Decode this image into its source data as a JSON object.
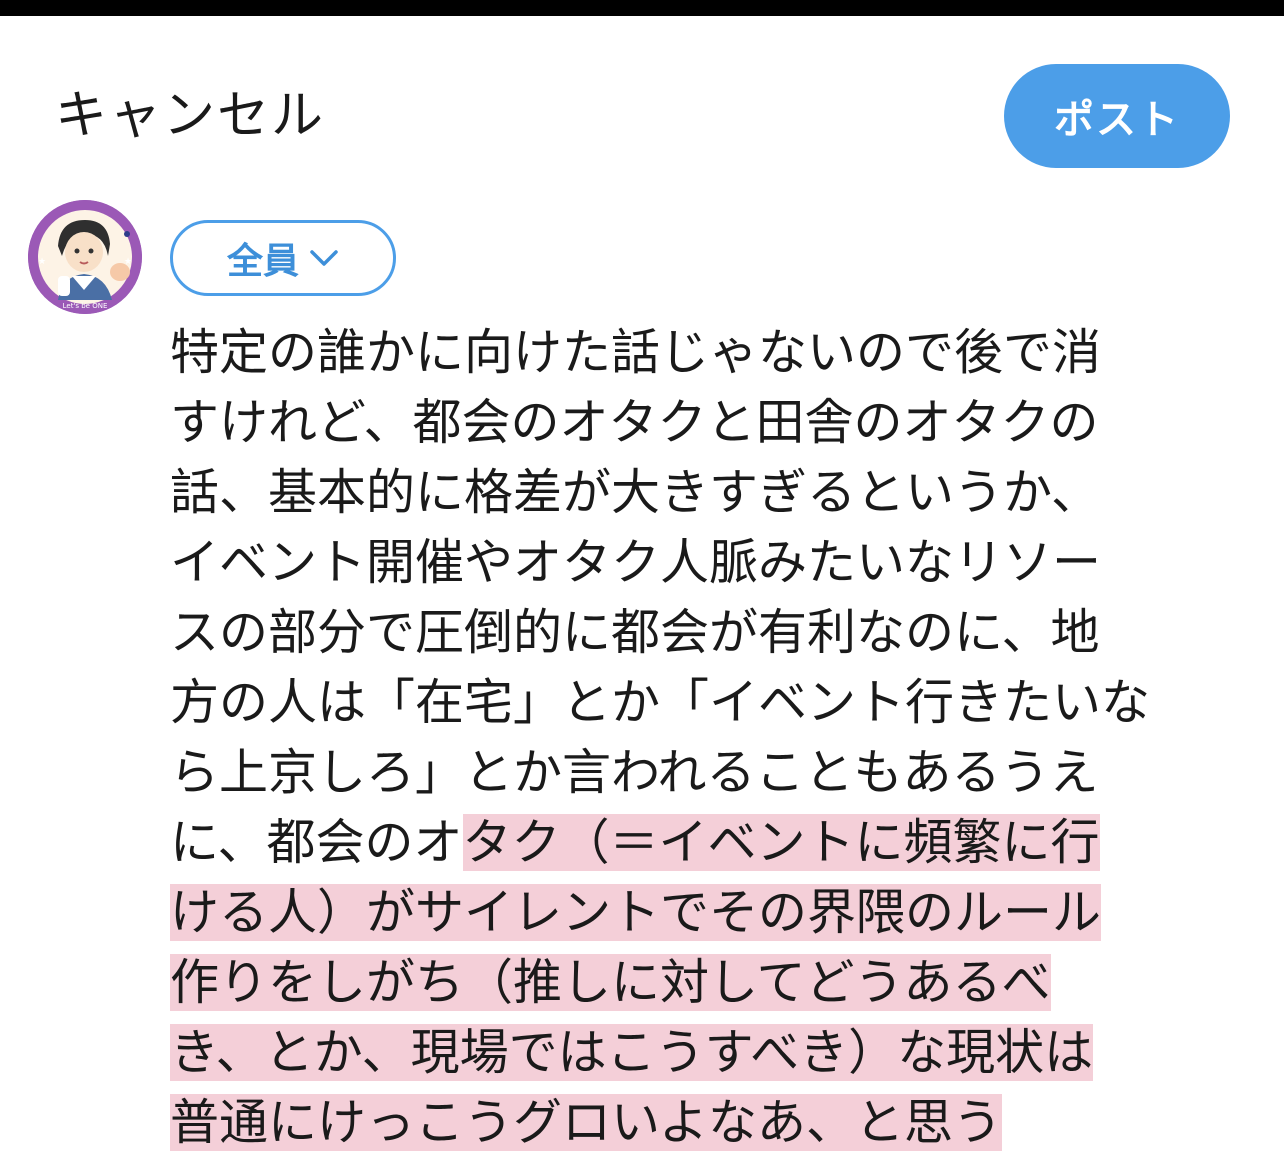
{
  "header": {
    "cancel_label": "キャンセル",
    "post_label": "ポスト"
  },
  "composer": {
    "audience_label": "全員",
    "avatar_caption": "Let's be ONE",
    "lines": [
      {
        "plain": "特定の誰かに向けた話じゃないので後で消",
        "highlight": ""
      },
      {
        "plain": "すけれど、都会のオタクと田舎のオタクの",
        "highlight": ""
      },
      {
        "plain": "話、基本的に格差が大きすぎるというか、",
        "highlight": ""
      },
      {
        "plain": "イベント開催やオタク人脈みたいなリソー",
        "highlight": ""
      },
      {
        "plain": "スの部分で圧倒的に都会が有利なのに、地",
        "highlight": ""
      },
      {
        "plain": "方の人は「在宅」とか「イベント行きたいな",
        "highlight": ""
      },
      {
        "plain": "ら上京しろ」とか言われることもあるうえ",
        "highlight": ""
      },
      {
        "plain": "に、都会のオ",
        "highlight": "タク（＝イベントに頻繁に行"
      },
      {
        "plain": "",
        "highlight": "ける人）がサイレントでその界隈のルール"
      },
      {
        "plain": "",
        "highlight": "作りをしがち（推しに対してどうあるべ"
      },
      {
        "plain": "",
        "highlight": "き、とか、現場ではこうすべき）な現状は"
      },
      {
        "plain": "",
        "highlight": "普通にけっこうグロいよなあ、と思う"
      }
    ]
  },
  "colors": {
    "accent": "#4c9ee8",
    "highlight": "#f4cfd8",
    "avatar_ring": "#9b59b6"
  }
}
